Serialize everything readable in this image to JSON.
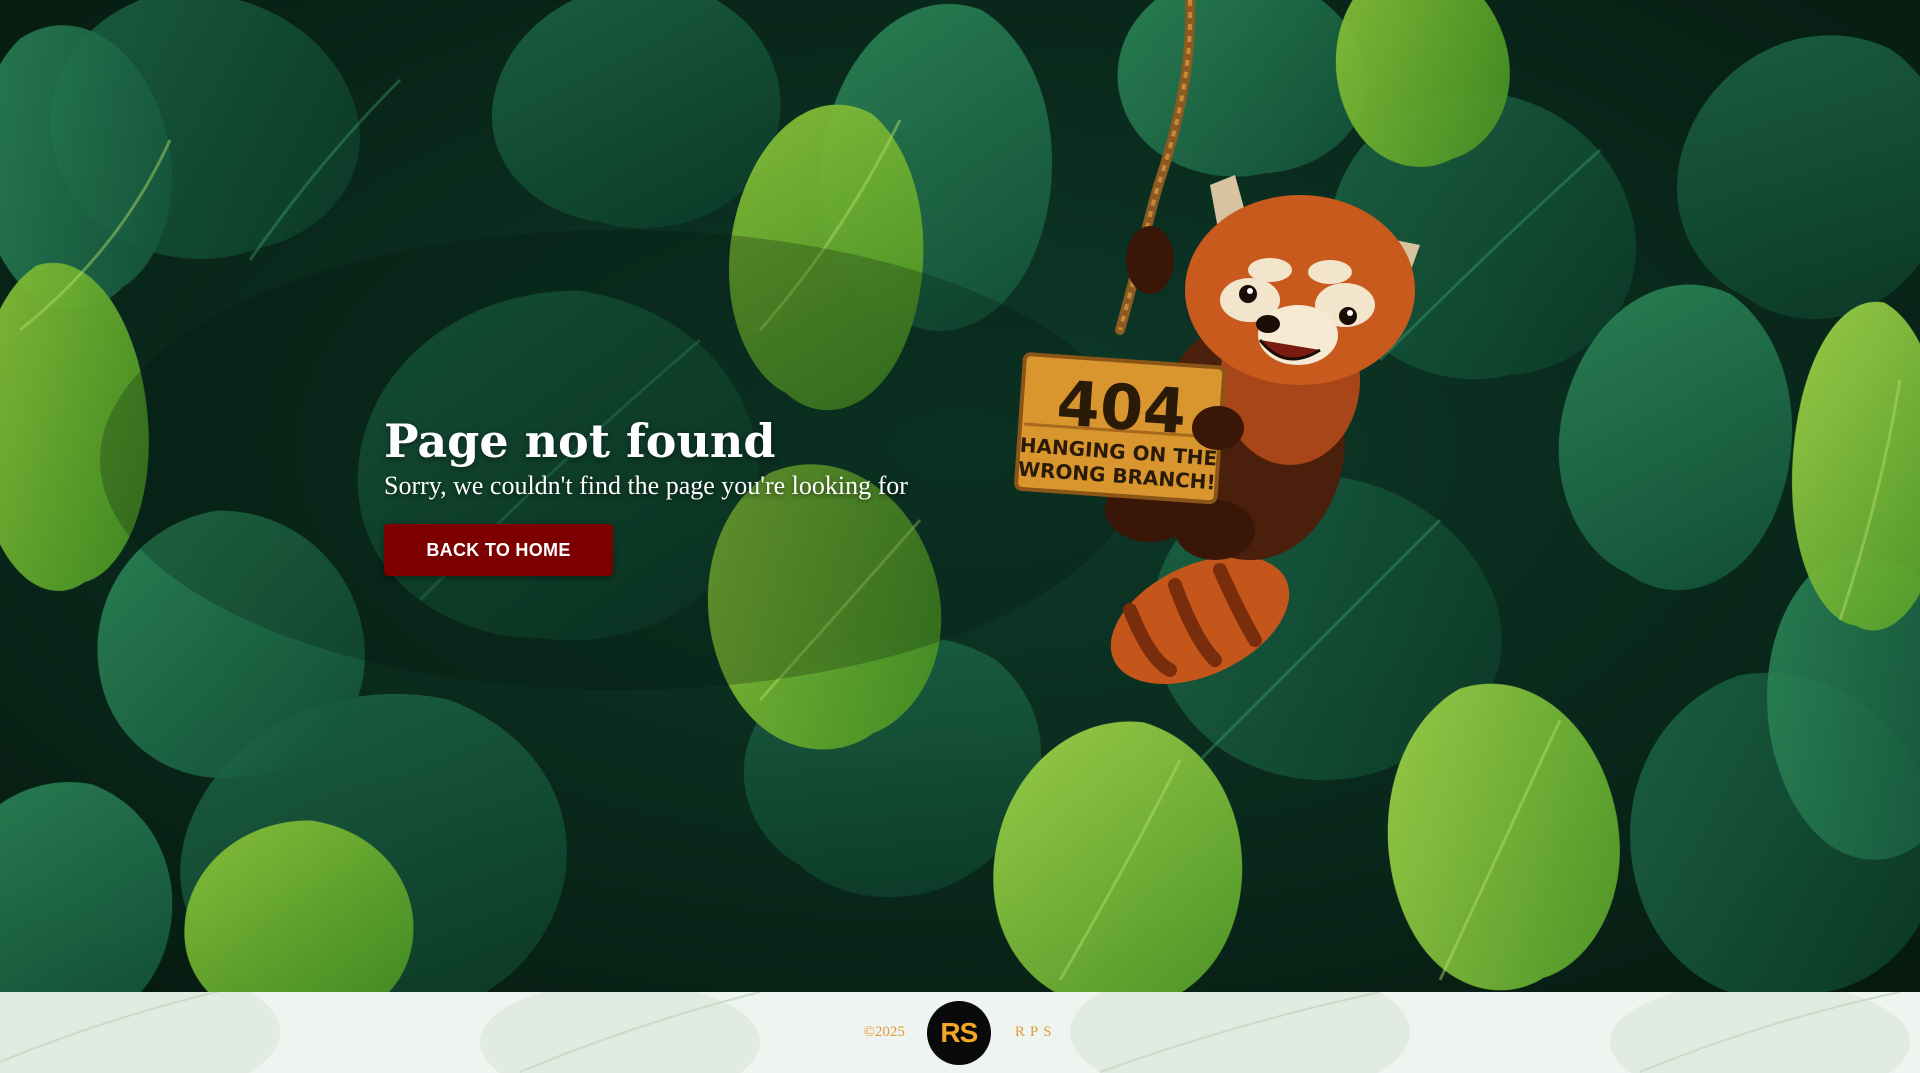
{
  "hero": {
    "title": "Page not found",
    "subtitle": "Sorry, we couldn't find the page you're looking for",
    "button_label": "BACK TO HOME"
  },
  "illustration": {
    "sign_code": "404",
    "sign_line1": "HANGING ON THE",
    "sign_line2": "WRONG BRANCH!"
  },
  "footer": {
    "copyright": "©2025",
    "logo_text": "RS",
    "brand": "RPS"
  },
  "colors": {
    "button_bg": "#7d0000",
    "footer_accent": "#e39a3c",
    "logo_text": "#f5a623",
    "background": "#0b2a1e"
  }
}
